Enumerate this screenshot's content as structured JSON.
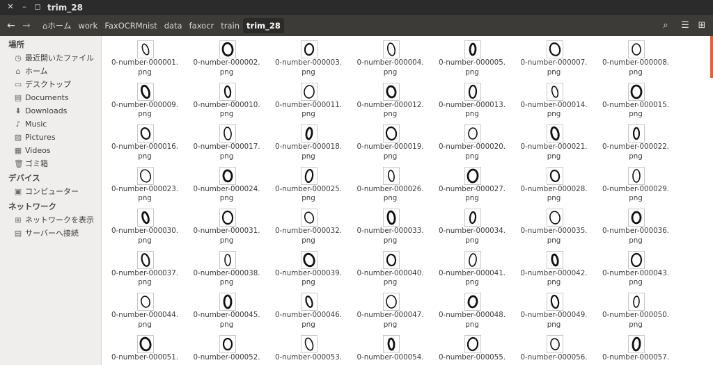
{
  "window": {
    "title": "trim_28"
  },
  "breadcrumb": [
    "ホーム",
    "work",
    "FaxOCRMnist",
    "data",
    "faxocr",
    "train",
    "trim_28"
  ],
  "sidebar": {
    "places_heading": "場所",
    "places": [
      {
        "label": "最近開いたファイル",
        "icon": "clock-icon"
      },
      {
        "label": "ホーム",
        "icon": "home-icon"
      },
      {
        "label": "デスクトップ",
        "icon": "desktop-icon"
      },
      {
        "label": "Documents",
        "icon": "documents-icon"
      },
      {
        "label": "Downloads",
        "icon": "download-icon"
      },
      {
        "label": "Music",
        "icon": "music-icon"
      },
      {
        "label": "Pictures",
        "icon": "pictures-icon"
      },
      {
        "label": "Videos",
        "icon": "videos-icon"
      },
      {
        "label": "ゴミ箱",
        "icon": "trash-icon"
      }
    ],
    "devices_heading": "デバイス",
    "devices": [
      {
        "label": "コンピューター",
        "icon": "computer-icon"
      }
    ],
    "network_heading": "ネットワーク",
    "network": [
      {
        "label": "ネットワークを表示",
        "icon": "network-icon"
      },
      {
        "label": "サーバーへ接続",
        "icon": "server-icon"
      }
    ]
  },
  "files": [
    {
      "line1": "0-number-000001.",
      "line2": "png"
    },
    {
      "line1": "0-number-000002.",
      "line2": "png"
    },
    {
      "line1": "0-number-000003.",
      "line2": "png"
    },
    {
      "line1": "0-number-000004.",
      "line2": "png"
    },
    {
      "line1": "0-number-000005.",
      "line2": "png"
    },
    {
      "line1": "0-number-000007.",
      "line2": "png"
    },
    {
      "line1": "0-number-000008.",
      "line2": "png"
    },
    {
      "line1": "0-number-000009.",
      "line2": "png"
    },
    {
      "line1": "0-number-000010.",
      "line2": "png"
    },
    {
      "line1": "0-number-000011.",
      "line2": "png"
    },
    {
      "line1": "0-number-000012.",
      "line2": "png"
    },
    {
      "line1": "0-number-000013.",
      "line2": "png"
    },
    {
      "line1": "0-number-000014.",
      "line2": "png"
    },
    {
      "line1": "0-number-000015.",
      "line2": "png"
    },
    {
      "line1": "0-number-000016.",
      "line2": "png"
    },
    {
      "line1": "0-number-000017.",
      "line2": "png"
    },
    {
      "line1": "0-number-000018.",
      "line2": "png"
    },
    {
      "line1": "0-number-000019.",
      "line2": "png"
    },
    {
      "line1": "0-number-000020.",
      "line2": "png"
    },
    {
      "line1": "0-number-000021.",
      "line2": "png"
    },
    {
      "line1": "0-number-000022.",
      "line2": "png"
    },
    {
      "line1": "0-number-000023.",
      "line2": "png"
    },
    {
      "line1": "0-number-000024.",
      "line2": "png"
    },
    {
      "line1": "0-number-000025.",
      "line2": "png"
    },
    {
      "line1": "0-number-000026.",
      "line2": "png"
    },
    {
      "line1": "0-number-000027.",
      "line2": "png"
    },
    {
      "line1": "0-number-000028.",
      "line2": "png"
    },
    {
      "line1": "0-number-000029.",
      "line2": "png"
    },
    {
      "line1": "0-number-000030.",
      "line2": "png"
    },
    {
      "line1": "0-number-000031.",
      "line2": "png"
    },
    {
      "line1": "0-number-000032.",
      "line2": "png"
    },
    {
      "line1": "0-number-000033.",
      "line2": "png"
    },
    {
      "line1": "0-number-000034.",
      "line2": "png"
    },
    {
      "line1": "0-number-000035.",
      "line2": "png"
    },
    {
      "line1": "0-number-000036.",
      "line2": "png"
    },
    {
      "line1": "0-number-000037.",
      "line2": "png"
    },
    {
      "line1": "0-number-000038.",
      "line2": "png"
    },
    {
      "line1": "0-number-000039.",
      "line2": "png"
    },
    {
      "line1": "0-number-000040.",
      "line2": "png"
    },
    {
      "line1": "0-number-000041.",
      "line2": "png"
    },
    {
      "line1": "0-number-000042.",
      "line2": "png"
    },
    {
      "line1": "0-number-000043.",
      "line2": "png"
    },
    {
      "line1": "0-number-000044.",
      "line2": "png"
    },
    {
      "line1": "0-number-000045.",
      "line2": "png"
    },
    {
      "line1": "0-number-000046.",
      "line2": "png"
    },
    {
      "line1": "0-number-000047.",
      "line2": "png"
    },
    {
      "line1": "0-number-000048.",
      "line2": "png"
    },
    {
      "line1": "0-number-000049.",
      "line2": "png"
    },
    {
      "line1": "0-number-000050.",
      "line2": "png"
    },
    {
      "line1": "0-number-000051.",
      "line2": ""
    },
    {
      "line1": "0-number-000052.",
      "line2": ""
    },
    {
      "line1": "0-number-000053.",
      "line2": ""
    },
    {
      "line1": "0-number-000054.",
      "line2": ""
    },
    {
      "line1": "0-number-000055.",
      "line2": ""
    },
    {
      "line1": "0-number-000056.",
      "line2": ""
    },
    {
      "line1": "0-number-000057.",
      "line2": ""
    }
  ]
}
